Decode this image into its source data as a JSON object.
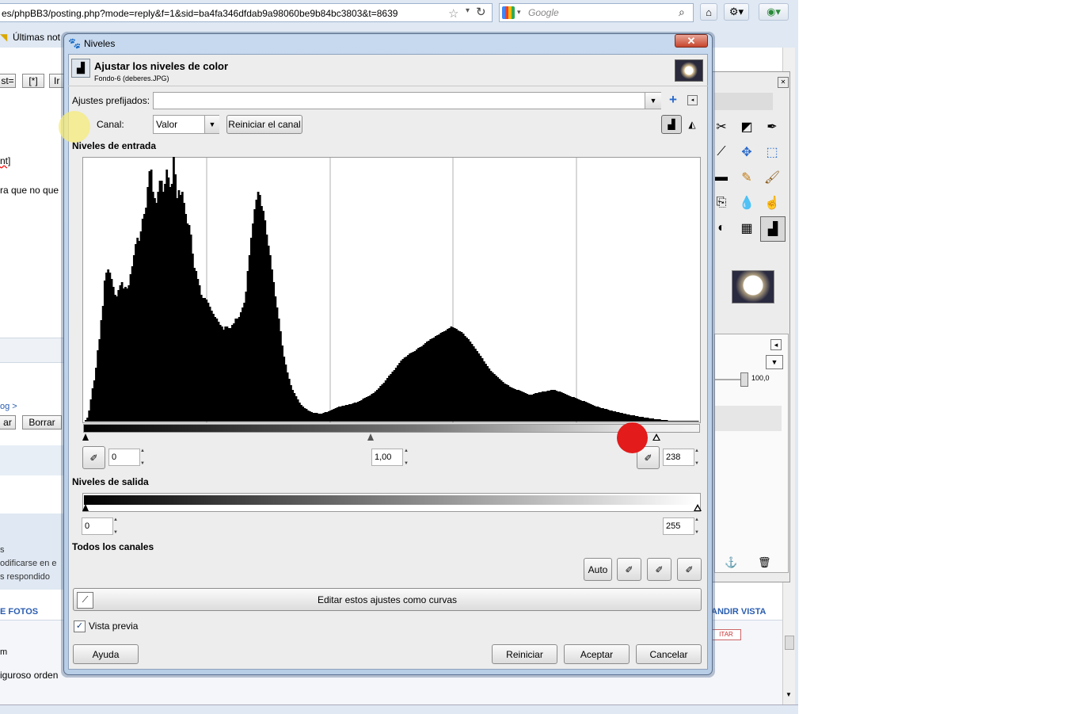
{
  "browser": {
    "url": "es/phpBB3/posting.php?mode=reply&f=1&sid=ba4fa346dfdab9a98060be9b84bc3803&t=8639",
    "search_placeholder": "Google",
    "bookmark": "Últimas not",
    "editor_buttons": [
      "st=",
      "[*]",
      "Ir"
    ],
    "left_texts": {
      "t1": "nt]",
      "t2": "ra que no que",
      "t3": "og >",
      "t4": "s",
      "t5": "odificarse en e",
      "t6": "s respondido",
      "t7": "E FOTOS",
      "t8": "m",
      "t9": "iguroso orden"
    },
    "form_buttons": {
      "left": "ar",
      "delete": "Borrar"
    },
    "right_link": "ANDIR VISTA",
    "right_button": "ITAR"
  },
  "toolbox": {
    "opacity_value": "100,0"
  },
  "dialog": {
    "window_title": "Niveles",
    "close_symbol": "✕",
    "heading": "Ajustar los niveles de color",
    "subheading": "Fondo-6 (deberes.JPG)",
    "presets_label": "Ajustes prefijados:",
    "presets_value": "",
    "channel_label": "Canal:",
    "channel_value": "Valor",
    "reset_channel": "Reiniciar el canal",
    "input_levels_label": "Niveles de entrada",
    "input_low": "0",
    "input_gamma": "1,00",
    "input_high": "238",
    "output_levels_label": "Niveles de salida",
    "output_low": "0",
    "output_high": "255",
    "all_channels_label": "Todos los canales",
    "auto_button": "Auto",
    "curves_button": "Editar estos ajustes como curvas",
    "preview_label": "Vista previa",
    "preview_checked": true,
    "help_button": "Ayuda",
    "reset_button": "Reiniciar",
    "ok_button": "Aceptar",
    "cancel_button": "Cancelar"
  },
  "histogram": [
    2,
    5,
    14,
    28,
    42,
    52,
    68,
    90,
    104,
    128,
    146,
    178,
    188,
    192,
    188,
    180,
    170,
    160,
    158,
    166,
    172,
    176,
    168,
    170,
    168,
    172,
    186,
    196,
    210,
    224,
    232,
    228,
    240,
    256,
    262,
    270,
    296,
    316,
    318,
    290,
    282,
    276,
    290,
    304,
    304,
    290,
    300,
    318,
    308,
    296,
    300,
    334,
    312,
    282,
    292,
    286,
    290,
    276,
    262,
    250,
    248,
    236,
    212,
    194,
    190,
    180,
    172,
    160,
    156,
    156,
    154,
    150,
    145,
    140,
    136,
    132,
    130,
    126,
    122,
    120,
    116,
    120,
    120,
    118,
    118,
    122,
    124,
    130,
    130,
    132,
    138,
    144,
    150,
    164,
    190,
    210,
    232,
    250,
    268,
    280,
    290,
    286,
    272,
    266,
    254,
    236,
    222,
    210,
    192,
    176,
    158,
    144,
    130,
    114,
    96,
    82,
    72,
    62,
    54,
    46,
    40,
    36,
    32,
    28,
    24,
    21,
    19,
    17,
    16,
    14,
    13,
    12,
    11,
    11,
    11,
    10,
    10,
    10,
    11,
    12,
    12,
    13,
    14,
    15,
    16,
    17,
    18,
    19,
    19,
    20,
    20,
    21,
    21,
    22,
    22,
    23,
    24,
    24,
    25,
    26,
    27,
    29,
    30,
    31,
    32,
    33,
    35,
    36,
    38,
    40,
    42,
    45,
    47,
    49,
    52,
    55,
    58,
    60,
    63,
    65,
    68,
    71,
    74,
    77,
    79,
    81,
    82,
    84,
    86,
    87,
    88,
    89,
    91,
    93,
    94,
    95,
    97,
    99,
    101,
    102,
    104,
    105,
    106,
    108,
    109,
    110,
    112,
    113,
    114,
    115,
    117,
    118,
    120,
    119,
    118,
    117,
    115,
    114,
    113,
    111,
    108,
    106,
    104,
    101,
    98,
    95,
    92,
    89,
    86,
    83,
    80,
    76,
    73,
    70,
    67,
    64,
    62,
    60,
    58,
    56,
    54,
    52,
    50,
    48,
    47,
    46,
    44,
    43,
    42,
    41,
    40,
    40,
    39,
    38,
    37,
    36,
    35,
    34,
    34,
    34,
    35,
    36,
    36,
    37,
    37,
    38,
    38,
    38,
    39,
    39,
    40,
    40,
    40,
    39,
    38,
    38,
    37,
    36,
    35,
    34,
    33,
    32,
    31,
    31,
    30,
    29,
    28,
    27,
    26,
    26,
    25,
    24,
    23,
    22,
    21,
    20,
    19,
    19,
    18,
    17,
    17,
    16,
    16,
    15,
    14,
    14,
    13,
    13,
    12,
    12,
    11,
    11,
    10,
    10,
    9,
    9,
    8,
    8,
    8,
    7,
    7,
    6,
    6,
    6,
    5,
    5,
    5,
    4,
    4,
    4,
    3,
    3,
    3,
    3,
    2,
    2,
    2,
    2,
    1,
    1,
    1,
    1,
    1,
    1,
    1,
    1,
    1,
    1,
    1,
    1,
    1,
    1,
    1,
    1,
    1,
    1
  ]
}
